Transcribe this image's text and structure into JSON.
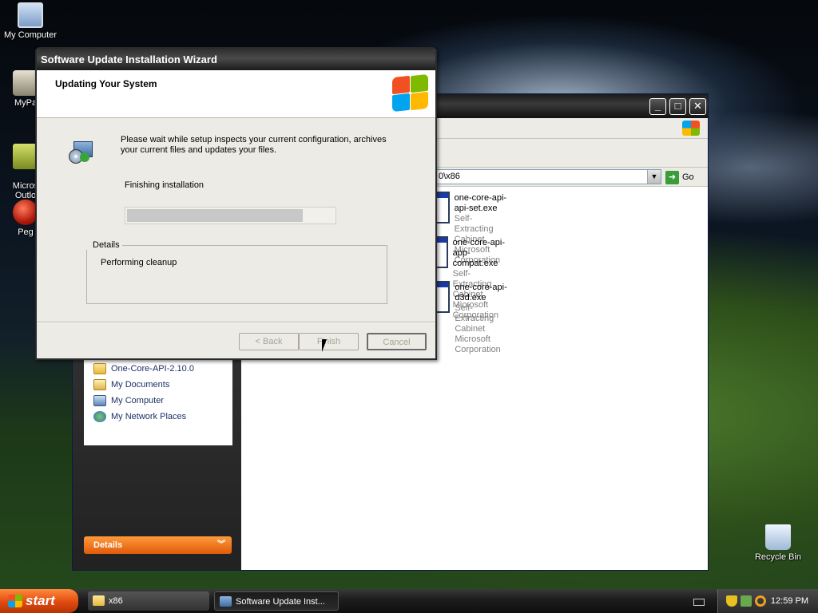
{
  "desktop": {
    "icons": [
      {
        "label": "My Computer"
      },
      {
        "label": "MyPa"
      },
      {
        "label": "Micros\nOutlo"
      },
      {
        "label": "Peg"
      },
      {
        "label": "Recycle Bin"
      }
    ]
  },
  "explorer": {
    "address": "0\\x86",
    "go_label": "Go",
    "other_places": [
      {
        "label": "One-Core-API-2.10.0",
        "icon": "folder-icon"
      },
      {
        "label": "My Documents",
        "icon": "my-documents-icon"
      },
      {
        "label": "My Computer",
        "icon": "my-computer-icon"
      },
      {
        "label": "My Network Places",
        "icon": "network-places-icon"
      }
    ],
    "details_label": "Details",
    "files": [
      {
        "name": "one-core-api-api-set.exe",
        "type": "Self-Extracting Cabinet",
        "company": "Microsoft Corporation"
      },
      {
        "name": "one-core-api-app-compat.exe",
        "type": "Self-Extracting Cabinet",
        "company": "Microsoft Corporation"
      },
      {
        "name": "one-core-api-d3d.exe",
        "type": "Self-Extracting Cabinet",
        "company": "Microsoft Corporation"
      }
    ]
  },
  "wizard": {
    "title": "Software Update Installation Wizard",
    "header": "Updating Your System",
    "description": "Please wait while setup inspects your current configuration, archives your current files and updates your files.",
    "status": "Finishing installation",
    "progress_fraction": 0.85,
    "details_label": "Details",
    "details_text": "Performing cleanup",
    "buttons": {
      "back": "< Back",
      "finish": "Finish",
      "cancel": "Cancel"
    }
  },
  "taskbar": {
    "start_label": "start",
    "tasks": [
      {
        "label": "x86"
      },
      {
        "label": "Software Update Inst..."
      }
    ],
    "clock": "12:59 PM"
  }
}
